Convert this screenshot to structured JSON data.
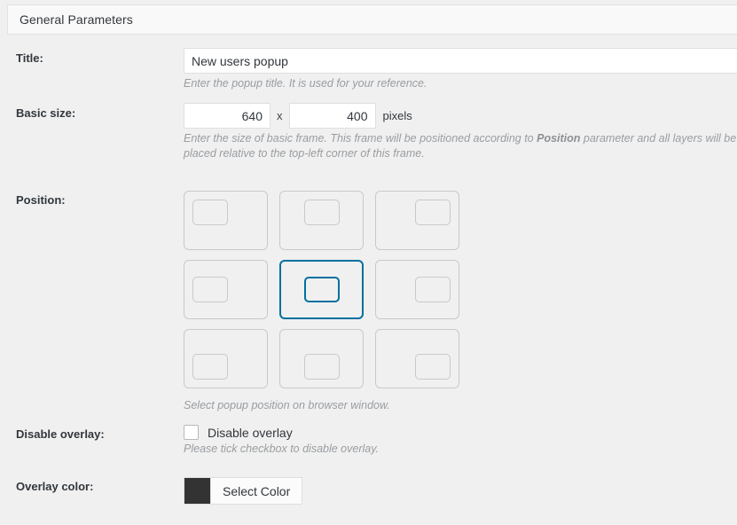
{
  "panel": {
    "header_title": "General Parameters"
  },
  "rows": {
    "title": {
      "label": "Title:",
      "value": "New users popup",
      "placeholder": "",
      "description": "Enter the popup title. It is used for your reference."
    },
    "basic_size": {
      "label": "Basic size:",
      "width_value": "640",
      "height_value": "400",
      "separator": "x",
      "unit": "pixels",
      "description_part1": "Enter the size of basic frame. This frame will be positioned according to ",
      "description_emphasis": "Position",
      "description_part2": " parameter and all layers will be placed relative to the top-left corner of this frame."
    },
    "position": {
      "label": "Position:",
      "description": "Select popup position on browser window.",
      "selected": "middle-center",
      "selected_color": "#00709f",
      "tiles": [
        {
          "id": "top-left",
          "name": "position-tile-top-left"
        },
        {
          "id": "top-center",
          "name": "position-tile-top-center"
        },
        {
          "id": "top-right",
          "name": "position-tile-top-right"
        },
        {
          "id": "middle-left",
          "name": "position-tile-middle-left"
        },
        {
          "id": "middle-center",
          "name": "position-tile-middle-center"
        },
        {
          "id": "middle-right",
          "name": "position-tile-middle-right"
        },
        {
          "id": "bottom-left",
          "name": "position-tile-bottom-left"
        },
        {
          "id": "bottom-center",
          "name": "position-tile-bottom-center"
        },
        {
          "id": "bottom-right",
          "name": "position-tile-bottom-right"
        }
      ]
    },
    "disable_overlay": {
      "label": "Disable overlay:",
      "checkbox_label": "Disable overlay",
      "checked": false,
      "description": "Please tick checkbox to disable overlay."
    },
    "overlay_color": {
      "label": "Overlay color:",
      "swatch_color": "#333333",
      "button_label": "Select Color"
    }
  }
}
